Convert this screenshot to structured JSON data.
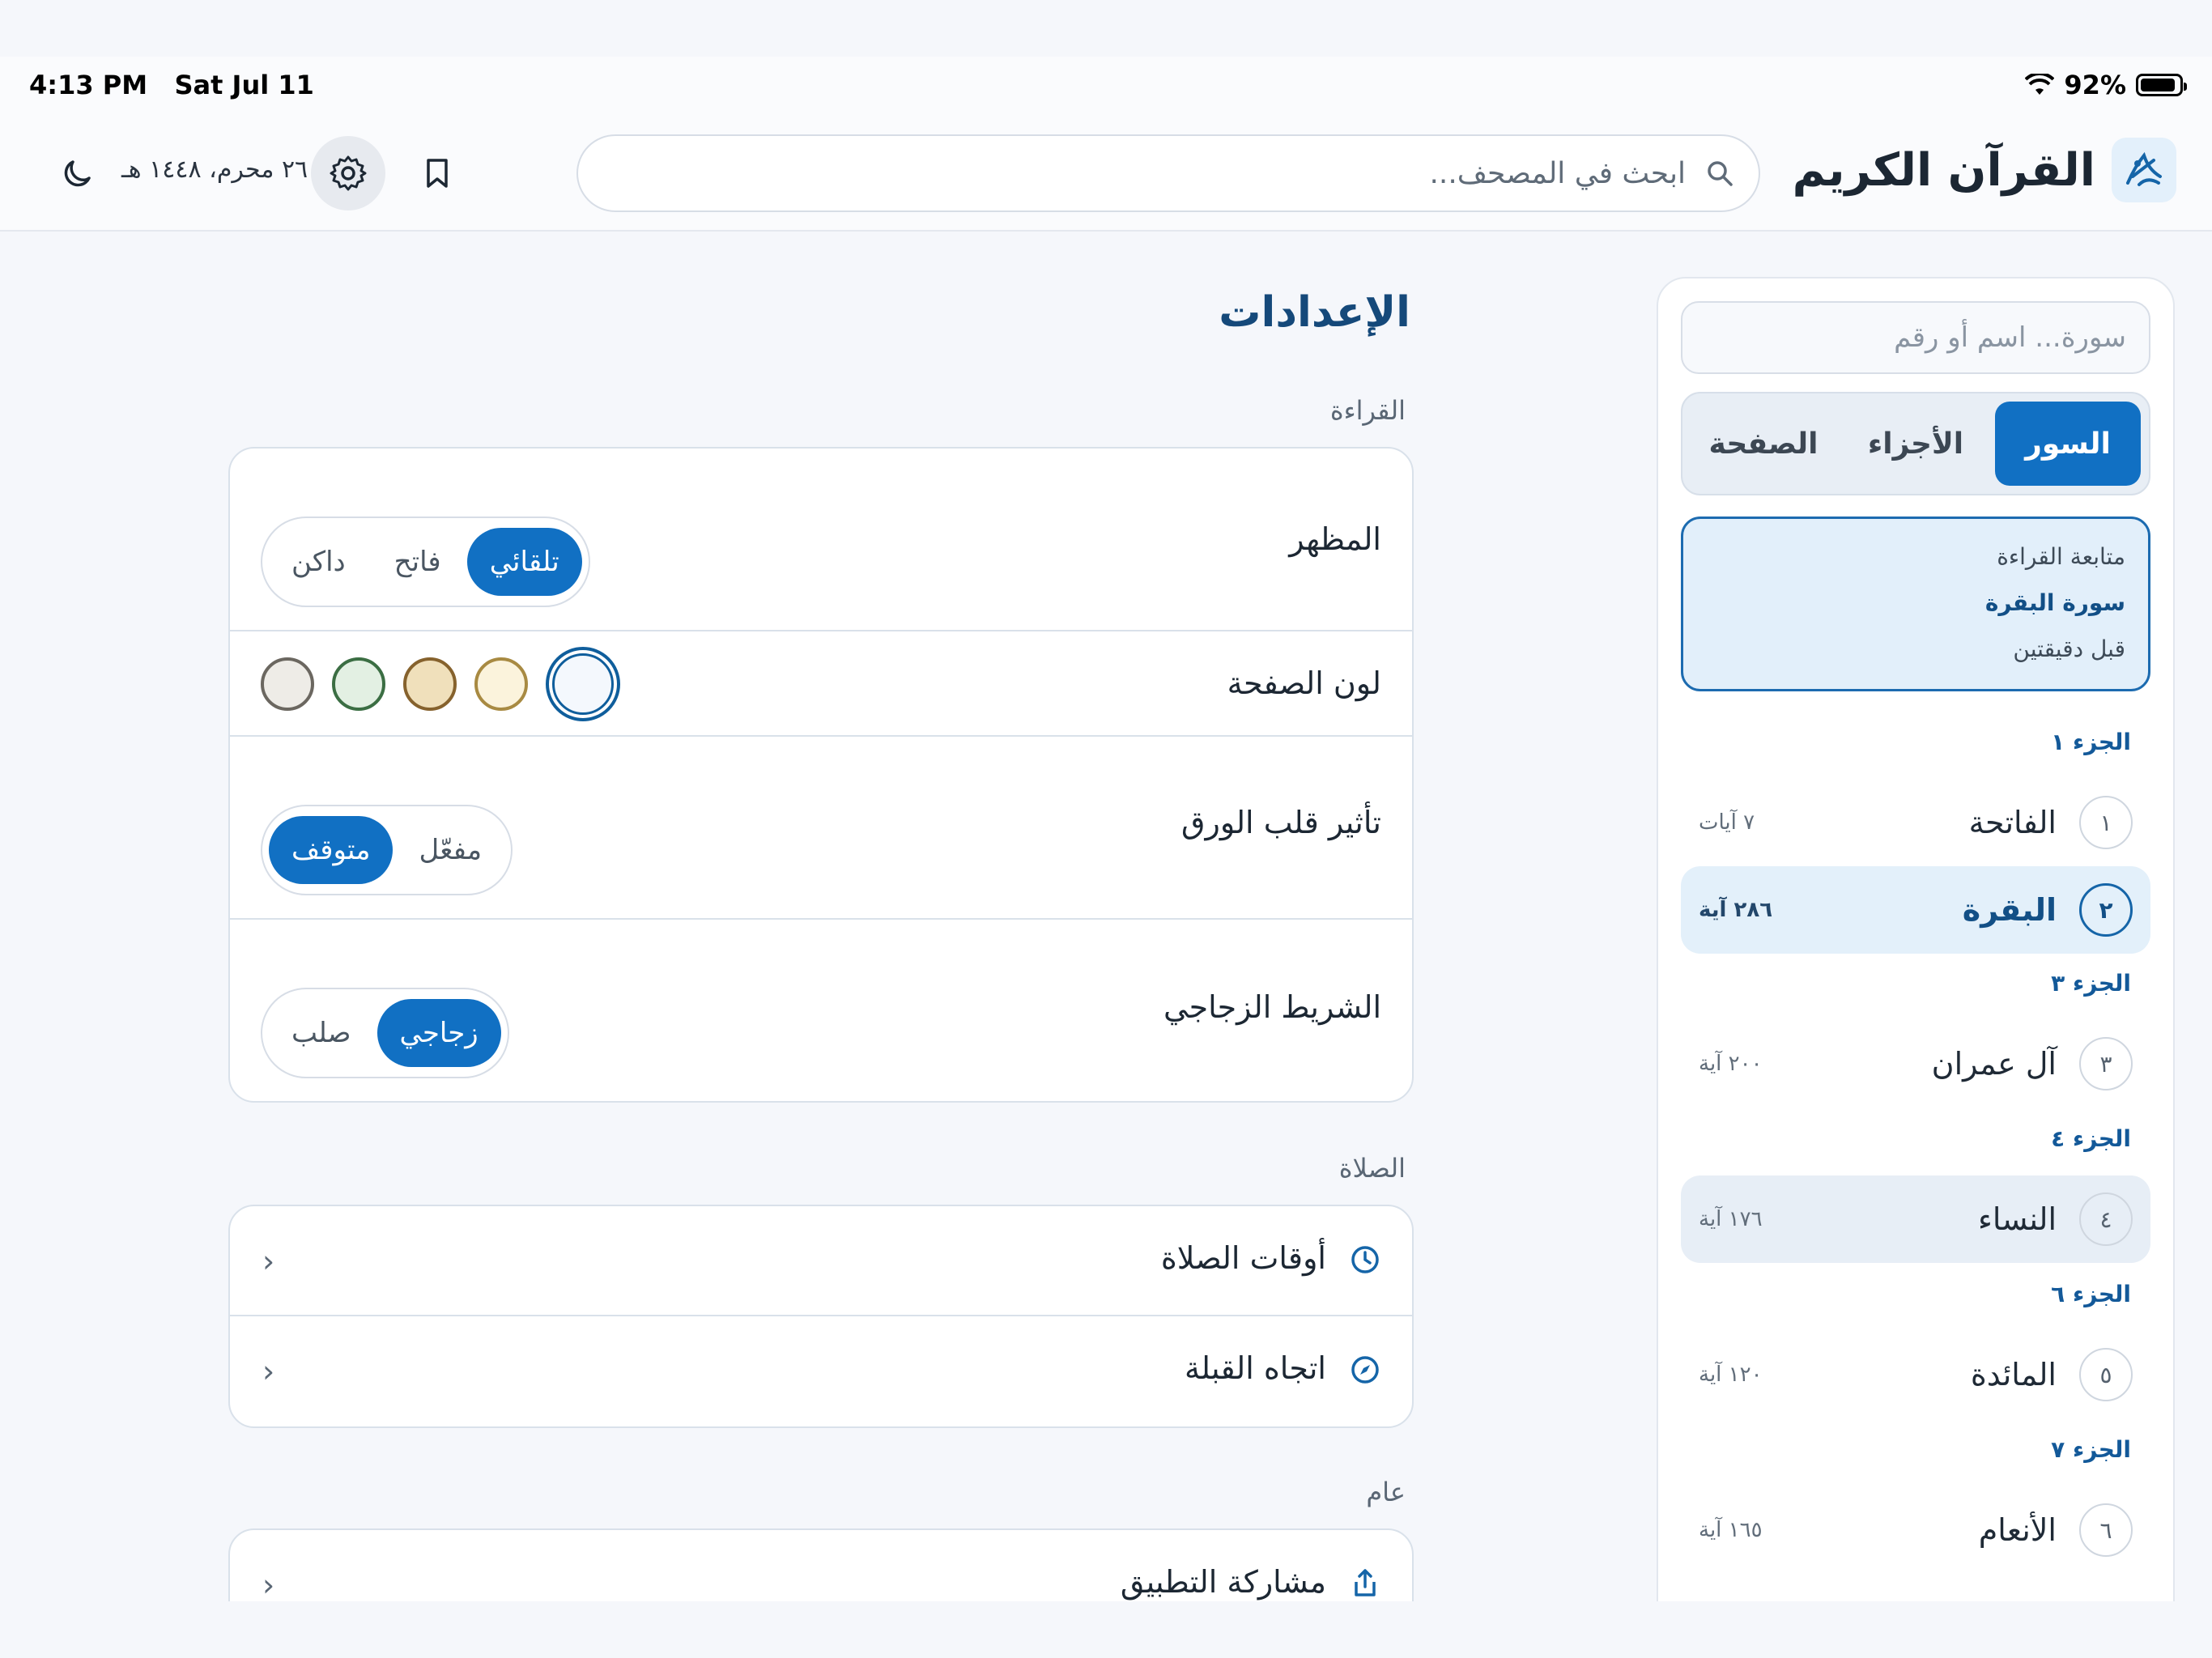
{
  "status_bar": {
    "time_date": "4:13 PM   Sat Jul 11",
    "battery": "92%",
    "battery_level": 0.92
  },
  "header": {
    "app_title": "القرآن الكريم",
    "search_placeholder": "ابحث في المصحف...",
    "hijri_date": "٢٦ محرم، ١٤٤٨ هـ",
    "icons": [
      "quran-logo-icon",
      "search-icon",
      "bookmark-icon",
      "gear-icon",
      "moon-icon"
    ]
  },
  "sidebar": {
    "search_placeholder": "سورة... اسم أو رقم",
    "tabs": [
      "السور",
      "الأجزاء",
      "الصفحة"
    ],
    "active_tab": "السور",
    "continue_reading": {
      "label": "متابعة القراءة",
      "surah": "سورة البقرة",
      "time": "قبل دقيقتين"
    },
    "juz_headers": [
      "الجزء ١",
      "الجزء ٣",
      "الجزء ٤",
      "الجزء ٦",
      "الجزء ٧"
    ],
    "surahs": [
      {
        "number": "١",
        "name": "الفاتحة",
        "ayahs": "٧ آيات"
      },
      {
        "number": "٢",
        "name": "البقرة",
        "ayahs": "٢٨٦ آية",
        "selected": true
      },
      {
        "number": "٣",
        "name": "آل عمران",
        "ayahs": "٢٠٠ آية"
      },
      {
        "number": "٤",
        "name": "النساء",
        "ayahs": "١٧٦ آية"
      },
      {
        "number": "٥",
        "name": "المائدة",
        "ayahs": "١٢٠ آية"
      },
      {
        "number": "٦",
        "name": "الأنعام",
        "ayahs": "١٦٥ آية"
      }
    ]
  },
  "settings": {
    "title": "الإعدادات",
    "reading_section": "القراءة",
    "appearance": {
      "label": "المظهر",
      "options": [
        "تلقائي",
        "فاتح",
        "داكن"
      ],
      "selected": "تلقائي"
    },
    "page_color": {
      "label": "لون الصفحة",
      "swatches": [
        {
          "fill": "#f4f8fd",
          "border": "#0f5e9c",
          "selected": true
        },
        {
          "fill": "#fbf3dc",
          "border": "#a88a42"
        },
        {
          "fill": "#f0e0bb",
          "border": "#86622d"
        },
        {
          "fill": "#e3f0e3",
          "border": "#3b6e43"
        },
        {
          "fill": "#eeece7",
          "border": "#6b6760"
        }
      ]
    },
    "page_flip": {
      "label": "تأثير قلب الورق",
      "options": [
        "مفعّل",
        "متوقف"
      ],
      "selected": "متوقف"
    },
    "glass_bar": {
      "label": "الشريط الزجاجي",
      "options": [
        "زجاجي",
        "صلب"
      ],
      "selected": "زجاجي"
    },
    "prayer_section": "الصلاة",
    "prayer_times": "أوقات الصلاة",
    "qibla": "اتجاه القبلة",
    "general_section": "عام",
    "share_app": "مشاركة التطبيق"
  },
  "colors": {
    "accent": "#1170c3",
    "title": "#15497a",
    "background": "#f5f7fb"
  }
}
